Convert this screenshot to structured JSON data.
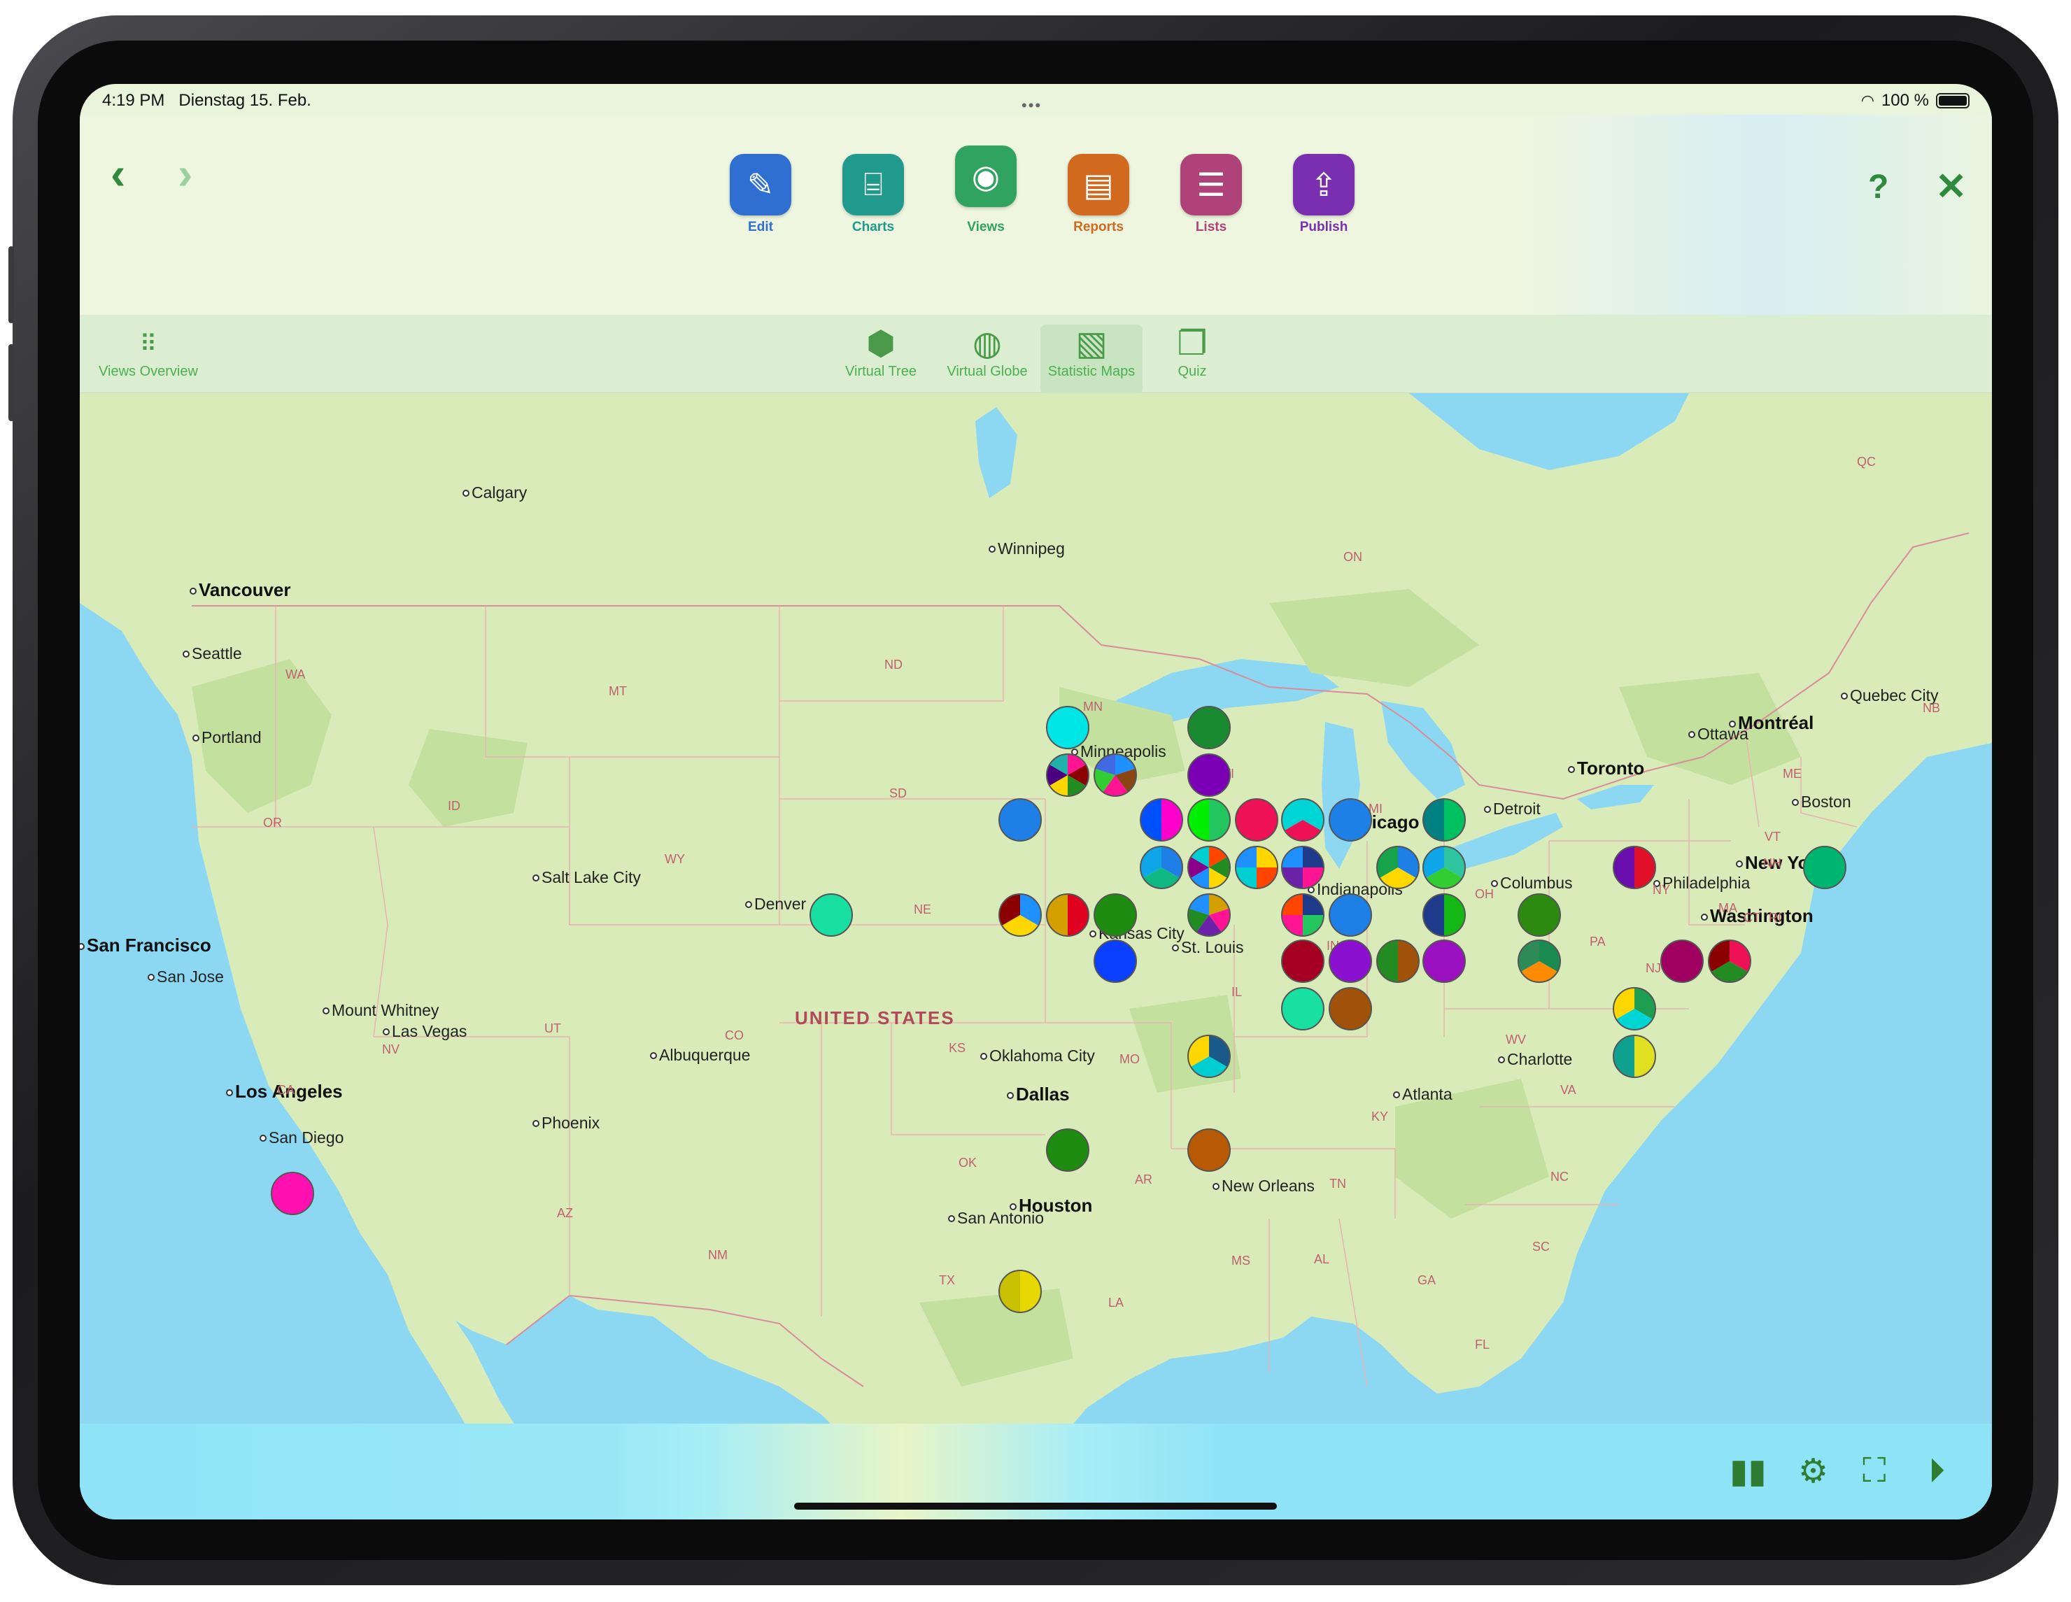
{
  "status": {
    "time": "4:19 PM",
    "date": "Dienstag 15. Feb.",
    "battery": "100 %"
  },
  "toolbar": {
    "back_icon": "chevron-left-icon",
    "forward_icon": "chevron-right-icon",
    "tools": [
      {
        "label": "Edit",
        "icon": "pencil-icon",
        "color": "#2f6fd1"
      },
      {
        "label": "Charts",
        "icon": "chart-icon",
        "color": "#1f9a8c"
      },
      {
        "label": "Views",
        "icon": "eye-icon",
        "color": "#2fa35f"
      },
      {
        "label": "Reports",
        "icon": "report-icon",
        "color": "#d1691f"
      },
      {
        "label": "Lists",
        "icon": "list-icon",
        "color": "#b0427a"
      },
      {
        "label": "Publish",
        "icon": "upload-icon",
        "color": "#7a2fb0"
      }
    ],
    "help_icon": "question-icon",
    "close_icon": "close-icon"
  },
  "subbar": {
    "overview": "Views Overview",
    "items": [
      {
        "label": "Virtual Tree",
        "icon": "cube-icon"
      },
      {
        "label": "Virtual Globe",
        "icon": "globe-icon"
      },
      {
        "label": "Statistic Maps",
        "icon": "map-icon",
        "selected": true
      },
      {
        "label": "Quiz",
        "icon": "quiz-icon"
      }
    ]
  },
  "map": {
    "country_label": "UNITED STATES",
    "cities": [
      {
        "name": "Calgary",
        "big": false
      },
      {
        "name": "Winnipeg",
        "big": false
      },
      {
        "name": "Vancouver",
        "big": true
      },
      {
        "name": "Seattle",
        "big": false
      },
      {
        "name": "Portland",
        "big": false
      },
      {
        "name": "Quebec City",
        "big": false
      },
      {
        "name": "Ottawa",
        "big": false
      },
      {
        "name": "Montréal",
        "big": true
      },
      {
        "name": "Toronto",
        "big": true
      },
      {
        "name": "Boston",
        "big": false
      },
      {
        "name": "New York",
        "big": true
      },
      {
        "name": "Philadelphia",
        "big": false
      },
      {
        "name": "Washington",
        "big": true
      },
      {
        "name": "Detroit",
        "big": false
      },
      {
        "name": "Chicago",
        "big": true
      },
      {
        "name": "Columbus",
        "big": false
      },
      {
        "name": "Indianapolis",
        "big": false
      },
      {
        "name": "Minneapolis",
        "big": false
      },
      {
        "name": "Salt Lake City",
        "big": false
      },
      {
        "name": "Denver",
        "big": false
      },
      {
        "name": "Kansas City",
        "big": false
      },
      {
        "name": "St. Louis",
        "big": false
      },
      {
        "name": "San Francisco",
        "big": true
      },
      {
        "name": "San Jose",
        "big": false
      },
      {
        "name": "Mount Whitney",
        "big": false
      },
      {
        "name": "Las Vegas",
        "big": false
      },
      {
        "name": "Los Angeles",
        "big": true
      },
      {
        "name": "San Diego",
        "big": false
      },
      {
        "name": "Phoenix",
        "big": false
      },
      {
        "name": "Albuquerque",
        "big": false
      },
      {
        "name": "Oklahoma City",
        "big": false
      },
      {
        "name": "Dallas",
        "big": true
      },
      {
        "name": "Houston",
        "big": true
      },
      {
        "name": "San Antonio",
        "big": false
      },
      {
        "name": "New Orleans",
        "big": false
      },
      {
        "name": "Atlanta",
        "big": false
      },
      {
        "name": "Charlotte",
        "big": false
      }
    ],
    "states": [
      "WA",
      "OR",
      "ID",
      "MT",
      "WY",
      "ND",
      "SD",
      "NE",
      "MN",
      "WI",
      "MI",
      "IL",
      "IN",
      "OH",
      "PA",
      "NY",
      "NJ",
      "MA",
      "CT",
      "RI",
      "NH",
      "VT",
      "ME",
      "CA",
      "NV",
      "UT",
      "CO",
      "KS",
      "MO",
      "KY",
      "WV",
      "VA",
      "NC",
      "TN",
      "OK",
      "AR",
      "TX",
      "LA",
      "MS",
      "AL",
      "GA",
      "SC",
      "FL",
      "AZ",
      "NM",
      "ON",
      "QC",
      "NB"
    ],
    "markers": [
      {
        "c": [
          "#00e5e5"
        ]
      },
      {
        "c": [
          "#ff1493",
          "#8b0000",
          "#228b22",
          "#ffd700",
          "#4b0082",
          "#20b2aa"
        ]
      },
      {
        "c": [
          "#1e90ff",
          "#8b4513",
          "#ff1493",
          "#32cd32",
          "#4169e1"
        ]
      },
      {
        "c": [
          "#7b00b5"
        ]
      },
      {
        "c": [
          "#1e80e6"
        ]
      },
      {
        "c": [
          "#ff00cc",
          "#0050ff"
        ]
      },
      {
        "c": [
          "#22c55e",
          "#00ee00"
        ]
      },
      {
        "c": [
          "#ee1155"
        ]
      },
      {
        "c": [
          "#00d5d5",
          "#ee1155",
          "#00d5d5"
        ]
      },
      {
        "c": [
          "#1e80e6"
        ]
      },
      {
        "c": [
          "#00c060",
          "#008080"
        ]
      },
      {
        "c": [
          "#1e80e6",
          "#10b981",
          "#0ea5e9"
        ]
      },
      {
        "c": [
          "#ff4500",
          "#228b22",
          "#ffd700",
          "#1e90ff",
          "#8b008b",
          "#00ced1"
        ]
      },
      {
        "c": [
          "#ffd700",
          "#ff4500",
          "#00ced1",
          "#1e90ff"
        ]
      },
      {
        "c": [
          "#1e3a8a",
          "#ff1493",
          "#6b21a8",
          "#1e90ff"
        ]
      },
      {
        "c": [
          "#1e80e6",
          "#ffd700",
          "#16a34a"
        ]
      },
      {
        "c": [
          "#2ec4a0",
          "#32cd32",
          "#0ea5e9"
        ]
      },
      {
        "c": [
          "#17e0a0"
        ]
      },
      {
        "c": [
          "#1e90ff",
          "#ffd700",
          "#8b0000"
        ]
      },
      {
        "c": [
          "#e00020",
          "#d4a000"
        ]
      },
      {
        "c": [
          "#1e8c10"
        ]
      },
      {
        "c": [
          "#d4a000",
          "#ff1493",
          "#6b21a8",
          "#228b22",
          "#1e90ff"
        ]
      },
      {
        "c": [
          "#0a3fff"
        ]
      },
      {
        "c": [
          "#1e3a8a",
          "#22c55e",
          "#ff1493",
          "#ff4500"
        ]
      },
      {
        "c": [
          "#1e80e6"
        ]
      },
      {
        "c": [
          "#14b814",
          "#1e3a8a"
        ]
      },
      {
        "c": [
          "#2d8a10"
        ]
      },
      {
        "c": [
          "#a50021"
        ]
      },
      {
        "c": [
          "#8b10d0"
        ]
      },
      {
        "c": [
          "#a0520a",
          "#228b22"
        ]
      },
      {
        "c": [
          "#9b10c0"
        ]
      },
      {
        "c": [
          "#1a8a50",
          "#ff8c00",
          "#2e8b57"
        ]
      },
      {
        "c": [
          "#a00060"
        ]
      },
      {
        "c": [
          "#ee1155",
          "#228b22",
          "#8b0000"
        ]
      },
      {
        "c": [
          "#e0102a",
          "#6a0dad"
        ]
      },
      {
        "c": [
          "#00b570"
        ]
      },
      {
        "c": [
          "#1e9e50",
          "#00d5d5",
          "#ffd700"
        ]
      },
      {
        "c": [
          "#e0e020",
          "#10a090"
        ]
      },
      {
        "c": [
          "#17e0a0"
        ]
      },
      {
        "c": [
          "#a0520a"
        ]
      },
      {
        "c": [
          "#1a5a8a",
          "#00ced1",
          "#ffd700"
        ]
      },
      {
        "c": [
          "#1e8c10"
        ]
      },
      {
        "c": [
          "#b85a05"
        ]
      },
      {
        "c": [
          "#e6d800",
          "#c8c000"
        ]
      },
      {
        "c": [
          "#ff10b0"
        ]
      },
      {
        "c": [
          "#1a8a30"
        ]
      }
    ]
  },
  "bottombar": {
    "icons": [
      "bar-chart-icon",
      "gear-icon",
      "screenshot-icon",
      "play-icon"
    ]
  }
}
